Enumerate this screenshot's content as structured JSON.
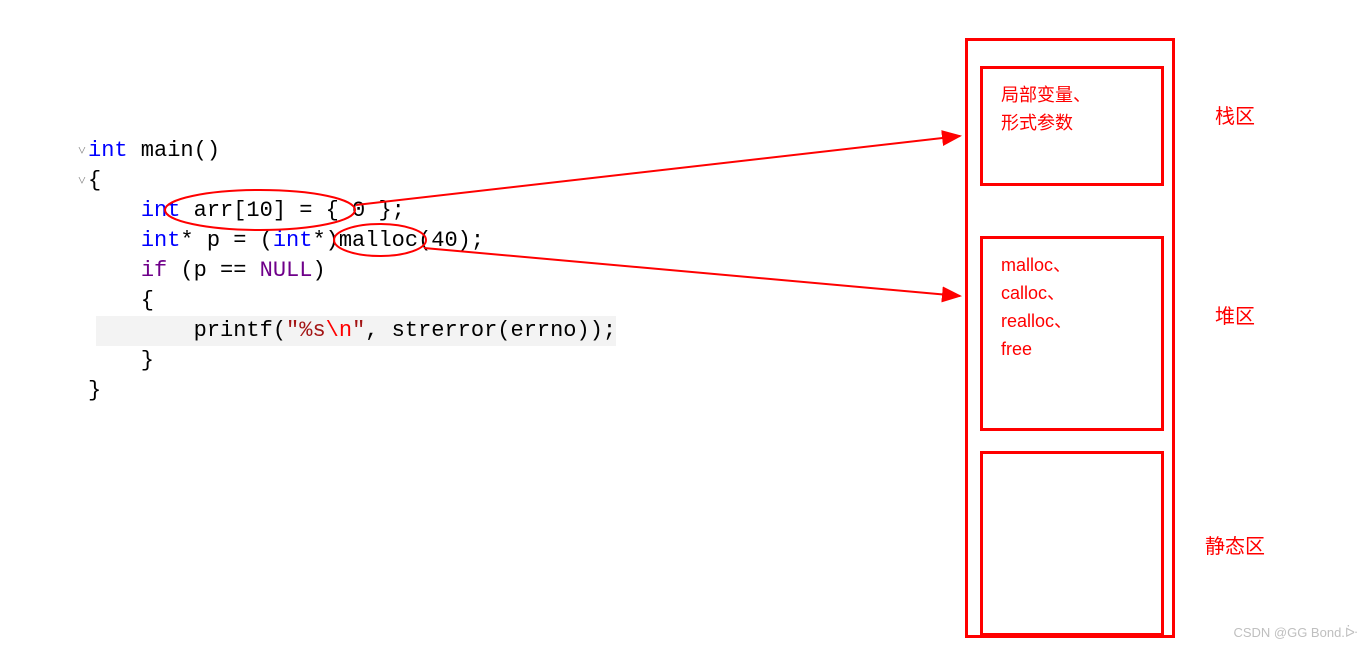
{
  "code": {
    "l1_kw": "int",
    "l1_rest": " main()",
    "l2": "{",
    "l3_indent": "    ",
    "l3_kw": "int",
    "l3_rest": " arr[10] = { 0 };",
    "l4_indent": "    ",
    "l4_a": "int",
    "l4_b": "* p = (",
    "l4_c": "int",
    "l4_d": "*)malloc(40);",
    "l5_indent": "    ",
    "l5_a": "if",
    "l5_b": " (p == ",
    "l5_c": "NULL",
    "l5_d": ")",
    "l6": "    {",
    "l7_indent": "        ",
    "l7_a": "printf(",
    "l7_b": "\"%s",
    "l7_c": "\\n",
    "l7_d": "\"",
    "l7_e": ", strerror(errno));",
    "l8": "    }",
    "l9": "}"
  },
  "memory": {
    "box1_line1": "局部变量、",
    "box1_line2": "形式参数",
    "box2_line1": "malloc、",
    "box2_line2": "calloc、",
    "box2_line3": "realloc、",
    "box2_line4": "free",
    "label1": "栈区",
    "label2": "堆区",
    "label3": "静态区"
  },
  "watermark": "CSDN @GG Bond.ᐕ",
  "colors": {
    "red": "#ff0000",
    "blue": "#0000ff",
    "purple": "#6f008a",
    "string": "#a31515"
  }
}
